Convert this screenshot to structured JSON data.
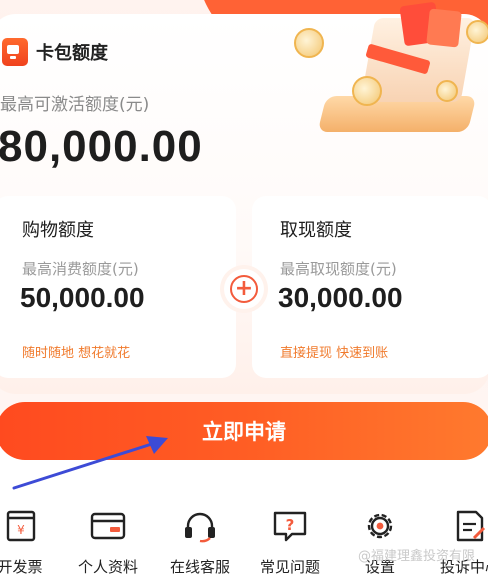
{
  "header": {
    "brand_title": "卡包额度",
    "limit_label": "最高可激活额度(元)",
    "limit_value": "80,000.00"
  },
  "shopping": {
    "title": "购物额度",
    "label": "最高消费额度(元)",
    "value": "50,000.00",
    "tag": "随时随地 想花就花"
  },
  "cash": {
    "title": "取现额度",
    "label": "最高取现额度(元)",
    "value": "30,000.00",
    "tag": "直接提现 快速到账"
  },
  "plus_symbol": "+",
  "apply_button": "立即申请",
  "nav": {
    "items": [
      {
        "label": "开发票",
        "icon": "invoice-icon"
      },
      {
        "label": "个人资料",
        "icon": "profile-card-icon"
      },
      {
        "label": "在线客服",
        "icon": "headset-icon"
      },
      {
        "label": "常见问题",
        "icon": "faq-icon"
      },
      {
        "label": "设置",
        "icon": "gear-icon"
      },
      {
        "label": "投诉中心",
        "icon": "complaint-icon"
      }
    ]
  },
  "watermark": "@福建理鑫投资有限",
  "colors": {
    "accent": "#ff5a2a",
    "tag_orange": "#f07a2c",
    "arrow_blue": "#3d4bd6"
  }
}
